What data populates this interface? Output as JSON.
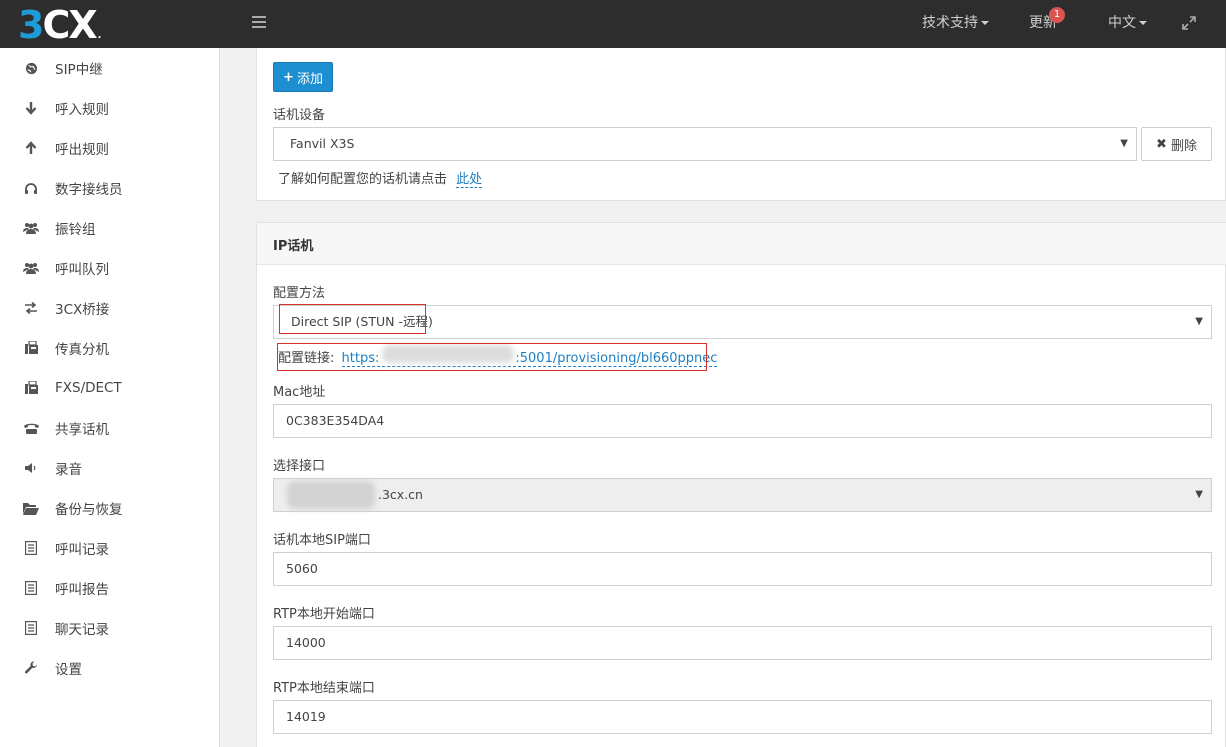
{
  "topbar": {
    "logo_three": "3",
    "logo_cx": "CX",
    "support_label": "技术支持",
    "update_label": "更新",
    "update_badge": "1",
    "language_label": "中文"
  },
  "sidebar": {
    "items": [
      {
        "label": "SIP中继",
        "icon": "globe-icon"
      },
      {
        "label": "呼入规则",
        "icon": "arrow-down-icon"
      },
      {
        "label": "呼出规则",
        "icon": "arrow-up-icon"
      },
      {
        "label": "数字接线员",
        "icon": "headphones-icon"
      },
      {
        "label": "振铃组",
        "icon": "users-icon"
      },
      {
        "label": "呼叫队列",
        "icon": "users-icon"
      },
      {
        "label": "3CX桥接",
        "icon": "exchange-icon"
      },
      {
        "label": "传真分机",
        "icon": "fax-icon"
      },
      {
        "label": "FXS/DECT",
        "icon": "fax-icon"
      },
      {
        "label": "共享话机",
        "icon": "phone-icon"
      },
      {
        "label": "录音",
        "icon": "volume-icon"
      },
      {
        "label": "备份与恢复",
        "icon": "folder-open-icon"
      },
      {
        "label": "呼叫记录",
        "icon": "list-icon"
      },
      {
        "label": "呼叫报告",
        "icon": "list-icon"
      },
      {
        "label": "聊天记录",
        "icon": "list-icon"
      },
      {
        "label": "设置",
        "icon": "wrench-icon"
      }
    ]
  },
  "device": {
    "add_button": "添加",
    "label": "话机设备",
    "selected": "Fanvil X3S",
    "delete_button": "删除",
    "help_text": "了解如何配置您的话机请点击",
    "help_link": "此处"
  },
  "ip_phone": {
    "title": "IP话机",
    "method_label": "配置方法",
    "method_value": "Direct SIP (STUN -远程)",
    "provision_label": "配置链接:",
    "provision_link_start": "https:",
    "provision_link_end": ":5001/provisioning/bl660ppnec",
    "mac_label": "Mac地址",
    "mac_value": "0C383E354DA4",
    "interface_label": "选择接口",
    "interface_value": ".3cx.cn",
    "sip_port_label": "话机本地SIP端口",
    "sip_port_value": "5060",
    "rtp_start_label": "RTP本地开始端口",
    "rtp_start_value": "14000",
    "rtp_end_label": "RTP本地结束端口",
    "rtp_end_value": "14019"
  },
  "colors": {
    "accent": "#1d8ed0",
    "topbar": "#2d2d2d",
    "highlight": "#d9302c"
  }
}
